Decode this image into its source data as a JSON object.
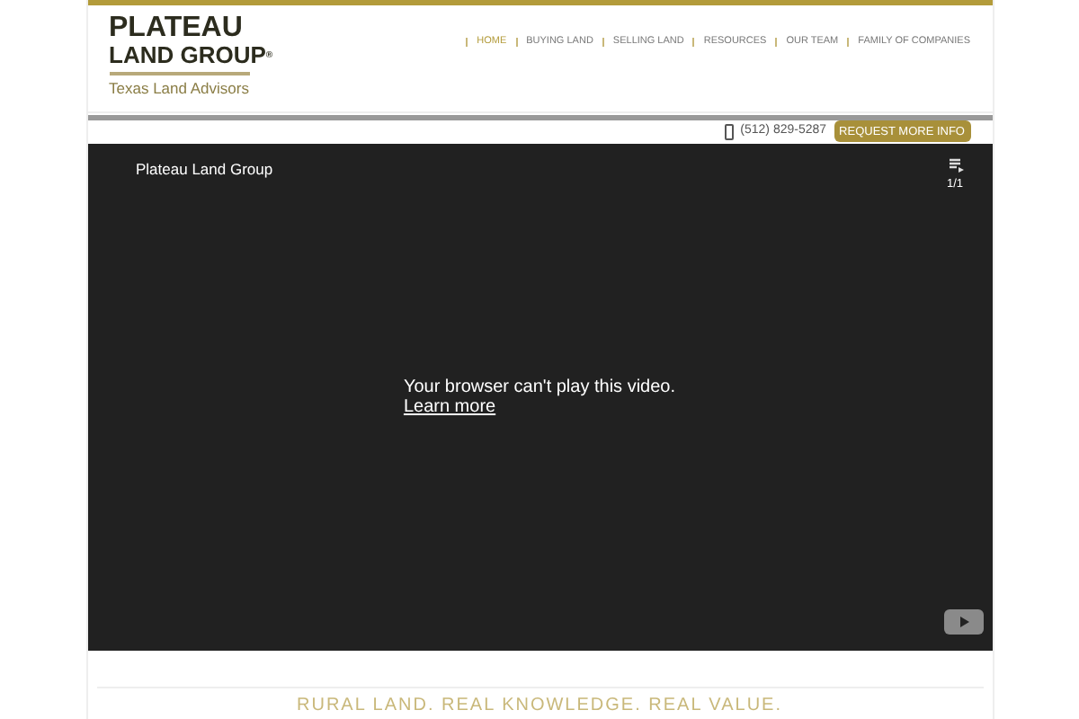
{
  "logo": {
    "line1": "PLATEAU",
    "line2": "LAND GROUP",
    "mark": "®",
    "tagline": "Texas Land Advisors"
  },
  "nav": [
    {
      "label": "HOME",
      "selected": true
    },
    {
      "label": "BUYING LAND",
      "selected": false
    },
    {
      "label": "SELLING LAND",
      "selected": false
    },
    {
      "label": "RESOURCES",
      "selected": false
    },
    {
      "label": "OUR TEAM",
      "selected": false
    },
    {
      "label": "FAMILY OF COMPANIES",
      "selected": false
    }
  ],
  "phone": "(512) 829-5287",
  "cta": "REQUEST MORE INFO",
  "video": {
    "title": "Plateau Land Group",
    "count": "1/1",
    "message": "Your browser can't play this video.",
    "link": "Learn more"
  },
  "tagline": "RURAL LAND. REAL KNOWLEDGE. REAL VALUE."
}
